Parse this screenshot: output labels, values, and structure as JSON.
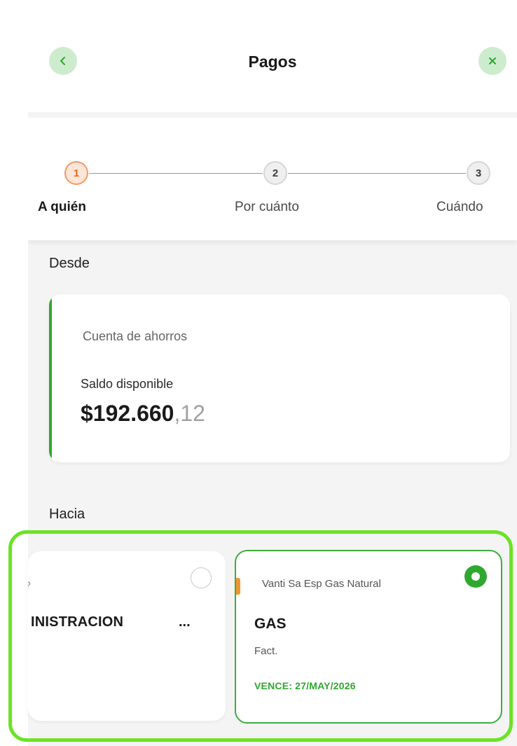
{
  "header": {
    "title": "Pagos",
    "back_icon": "chevron-left-icon",
    "close_icon": "close-icon",
    "icon_bg_color": "#cdeccd",
    "icon_color": "#2fa82f"
  },
  "stepper": {
    "steps": [
      {
        "number": "1",
        "label": "A quién",
        "state": "active"
      },
      {
        "number": "2",
        "label": "Por cuánto",
        "state": "pending"
      },
      {
        "number": "3",
        "label": "Cuándo",
        "state": "pending"
      }
    ],
    "active_color": "#f29a66"
  },
  "from": {
    "section_label": "Desde",
    "account_name": "Cuenta de ahorros",
    "balance_label": "Saldo disponible",
    "balance_main": "$192.660",
    "balance_cents": ",12",
    "accent_color": "#2fa82f"
  },
  "to": {
    "section_label": "Hacia",
    "cards": [
      {
        "partial_top": "?",
        "name": "INISTRACION",
        "more": "...",
        "selected": false
      },
      {
        "company": "Vanti Sa Esp Gas Natural",
        "name": "GAS",
        "detail": "Fact.",
        "due": "VENCE: 27/MAY/2026",
        "selected": true
      }
    ],
    "highlight_color": "#6be324",
    "selected_color": "#2fa82f"
  }
}
